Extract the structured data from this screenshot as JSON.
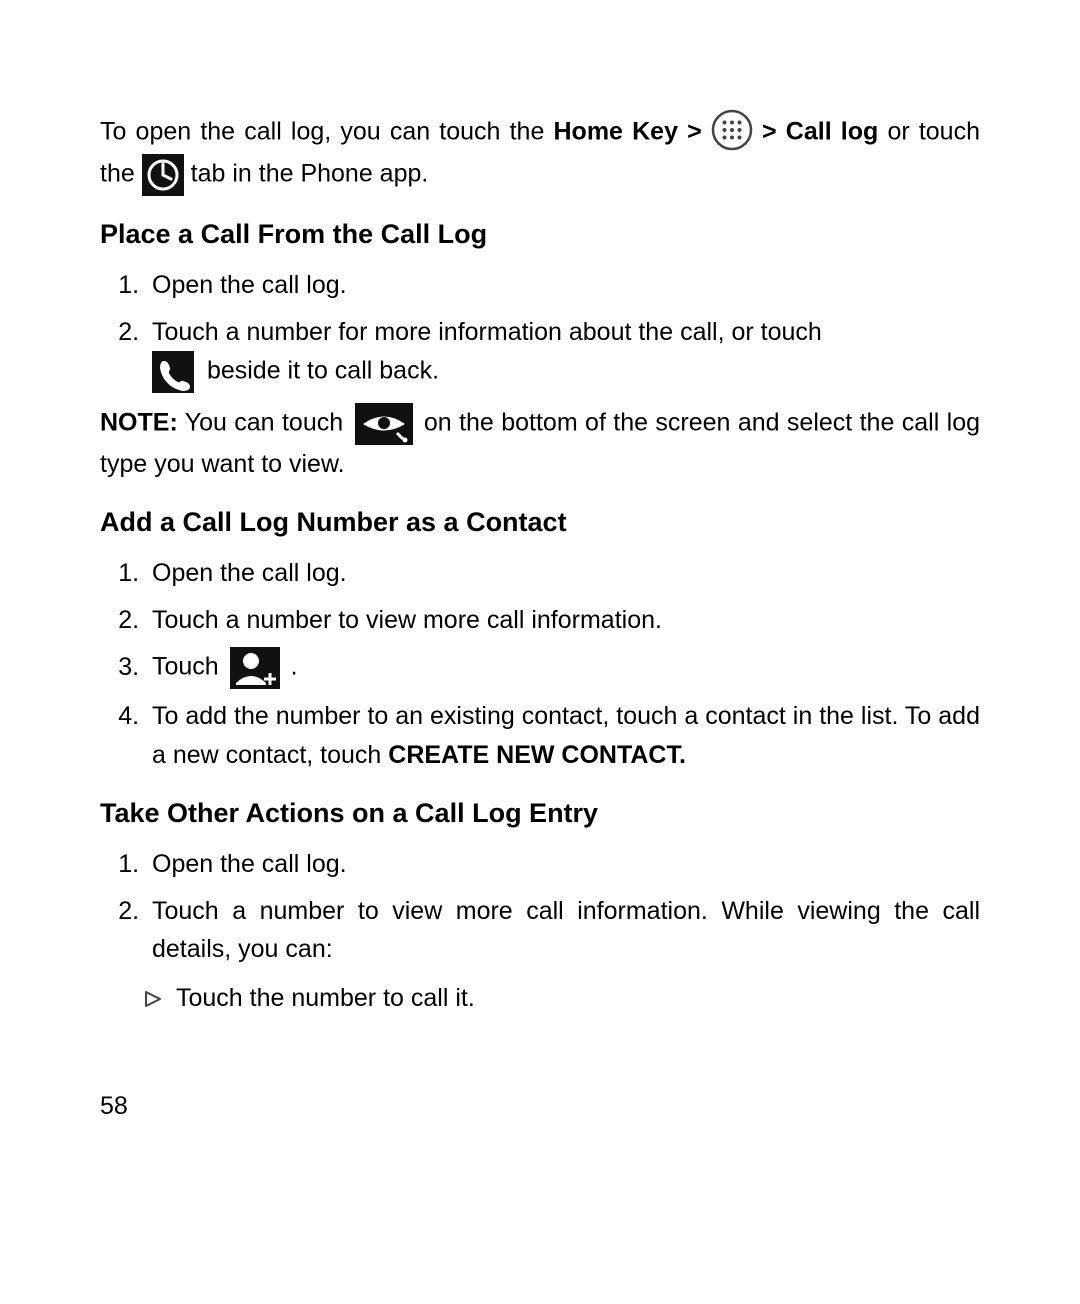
{
  "intro": {
    "part1": "To open the call log, you can touch the ",
    "home_key": "Home Key > ",
    "arrow_call": " > Call log",
    "or_touch": " or touch the ",
    "tab_tail": " tab in the Phone app."
  },
  "sections": {
    "place": {
      "heading": "Place a Call From the Call Log",
      "step1": "Open the call log.",
      "step2a": "Touch a number for more information about the call, or touch ",
      "step2b": " beside it to call back."
    },
    "note": {
      "label": "NOTE:",
      "part1": " You can touch ",
      "part2": " on the bottom of the screen and select the call log type you want to view."
    },
    "add": {
      "heading": "Add a Call Log Number as a Contact",
      "step1": "Open the call log.",
      "step2": "Touch a number to view more call information.",
      "step3a": "Touch ",
      "step3b": " .",
      "step4a": "To add the number to an existing contact, touch a contact in the list. To add a new contact, touch ",
      "step4b": "CREATE NEW CONTACT."
    },
    "actions": {
      "heading": "Take Other Actions on a Call Log Entry",
      "step1": "Open the call log.",
      "step2": "Touch a number to view more call information. While viewing the call details, you can:",
      "bullet1": "Touch the number to call it."
    }
  },
  "icons": {
    "apps": "apps-menu-icon",
    "clock": "clock-tab-icon",
    "phone": "phone-handset-icon",
    "eye": "view-eye-icon",
    "addcontact": "add-contact-icon",
    "triangle": "triangle-bullet-icon"
  },
  "page_number": "58"
}
